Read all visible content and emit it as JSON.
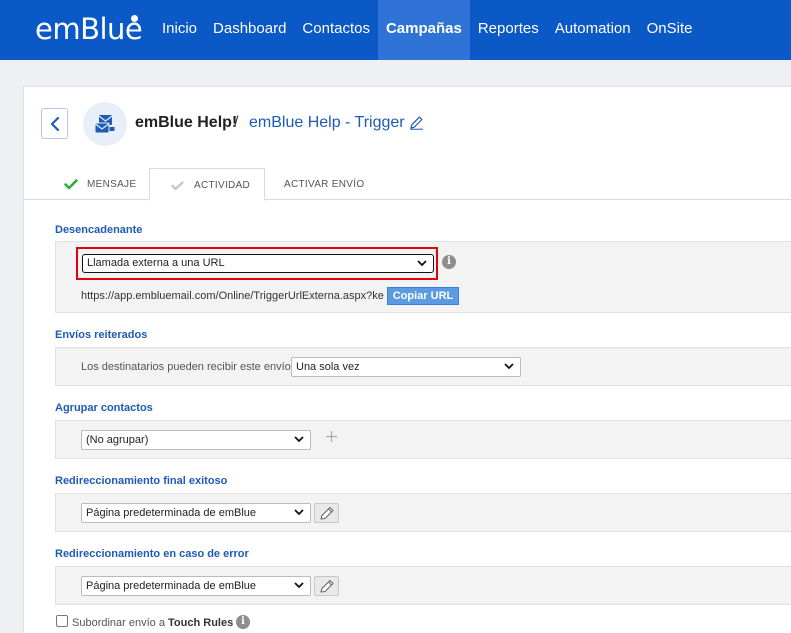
{
  "app": {
    "logo_text": "emBlue",
    "nav": [
      {
        "label": "Inicio",
        "active": false
      },
      {
        "label": "Dashboard",
        "active": false
      },
      {
        "label": "Contactos",
        "active": false
      },
      {
        "label": "Campañas",
        "active": true
      },
      {
        "label": "Reportes",
        "active": false
      },
      {
        "label": "Automation",
        "active": false
      },
      {
        "label": "OnSite",
        "active": false
      }
    ]
  },
  "header": {
    "breadcrumb_root": "emBlue Help!",
    "breadcrumb_separator": "/",
    "campaign_name": "emBlue Help - Trigger"
  },
  "tabs": [
    {
      "label": "MENSAJE",
      "status": "done"
    },
    {
      "label": "ACTIVIDAD",
      "status": "current"
    },
    {
      "label": "ACTIVAR ENVÍO",
      "status": "pending"
    }
  ],
  "trigger": {
    "title": "Desencadenante",
    "selected": "Llamada externa a una URL",
    "url": "https://app.embluemail.com/Online/TriggerUrlExterna.aspx?ke",
    "copy_button": "Copiar URL"
  },
  "repeat": {
    "title": "Envíos reiterados",
    "label": "Los destinatarios pueden recibir este envío",
    "selected": "Una sola vez"
  },
  "group": {
    "title": "Agrupar contactos",
    "selected": "(No agrupar)"
  },
  "redirect_success": {
    "title": "Redireccionamiento final exitoso",
    "selected": "Página predeterminada de emBlue"
  },
  "redirect_error": {
    "title": "Redireccionamiento en caso de error",
    "selected": "Página predeterminada de emBlue"
  },
  "touch_rules": {
    "label_prefix": "Subordinar envío a ",
    "label_bold": "Touch Rules",
    "checked": false
  },
  "colors": {
    "brand": "#0b58c7",
    "link": "#1d5bb5",
    "highlight": "#e3000f",
    "success": "#2eaa3c"
  }
}
